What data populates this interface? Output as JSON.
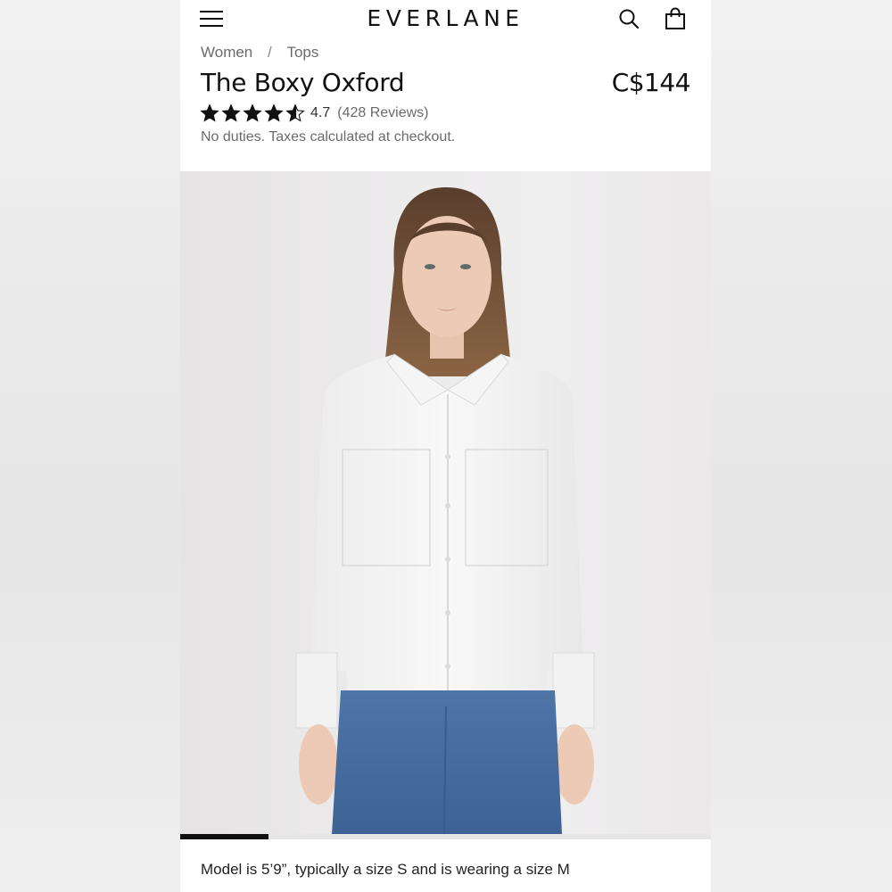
{
  "header": {
    "logo": "EVERLANE",
    "icons": [
      "menu-icon",
      "search-icon",
      "shopping-bag-icon"
    ]
  },
  "breadcrumb": {
    "items": [
      "Women",
      "Tops"
    ],
    "separator": "/"
  },
  "product": {
    "title": "The Boxy Oxford",
    "price": "C$144",
    "rating": "4.7",
    "rating_value": 4.7,
    "rating_max": 5,
    "reviews": "(428 Reviews)",
    "duties_note": "No duties. Taxes calculated at checkout."
  },
  "gallery": {
    "progress": 0.166,
    "model_note": "Model is 5’9”, typically a size S and is wearing a size M"
  },
  "colors": {
    "text": "#111111",
    "muted": "#6b6b6b",
    "progress_fill": "#111111",
    "progress_track": "#e6e6e6"
  }
}
